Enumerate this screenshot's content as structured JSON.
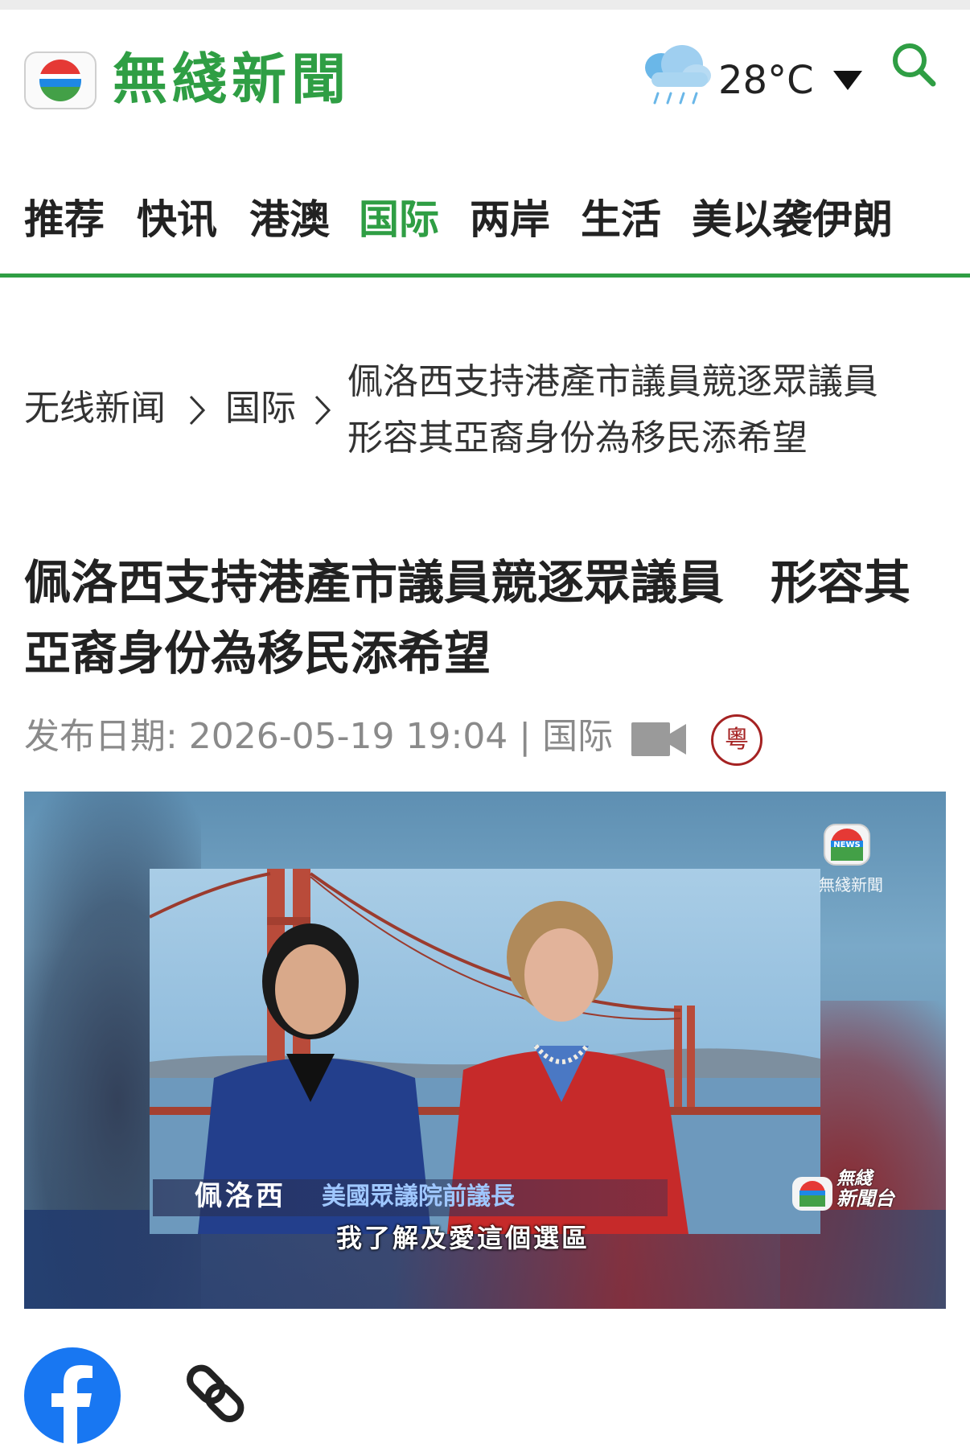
{
  "header": {
    "logo_text": "無綫新聞",
    "weather": {
      "icon": "rain-cloud-icon",
      "temperature": "28°C"
    }
  },
  "nav": {
    "items": [
      {
        "label": "推荐",
        "active": false
      },
      {
        "label": "快讯",
        "active": false
      },
      {
        "label": "港澳",
        "active": false
      },
      {
        "label": "国际",
        "active": true
      },
      {
        "label": "两岸",
        "active": false
      },
      {
        "label": "生活",
        "active": false
      },
      {
        "label": "美以袭伊朗",
        "active": false
      }
    ]
  },
  "breadcrumb": {
    "home": "无线新闻",
    "section": "国际",
    "current": "佩洛西支持港產市議員競逐眾議員　形容其亞裔身份為移民添希望"
  },
  "article": {
    "title": "佩洛西支持港產市議員競逐眾議員　形容其亞裔身份為移民添希望",
    "meta": "发布日期: 2026-05-19 19:04 | 国际",
    "lang_badge": "粵"
  },
  "video": {
    "watermark": "無綫新聞",
    "watermark_badge": "NEWS",
    "name_tag": "佩洛西",
    "role_tag": "美國眾議院前議長",
    "subtitle": "我了解及愛這個選區",
    "channel": [
      "無綫",
      "新聞台"
    ]
  },
  "share": {
    "items": [
      "facebook-icon",
      "link-icon"
    ]
  },
  "colors": {
    "brand_green": "#2f9e44",
    "facebook_blue": "#1877f2",
    "badge_red": "#a52222"
  }
}
